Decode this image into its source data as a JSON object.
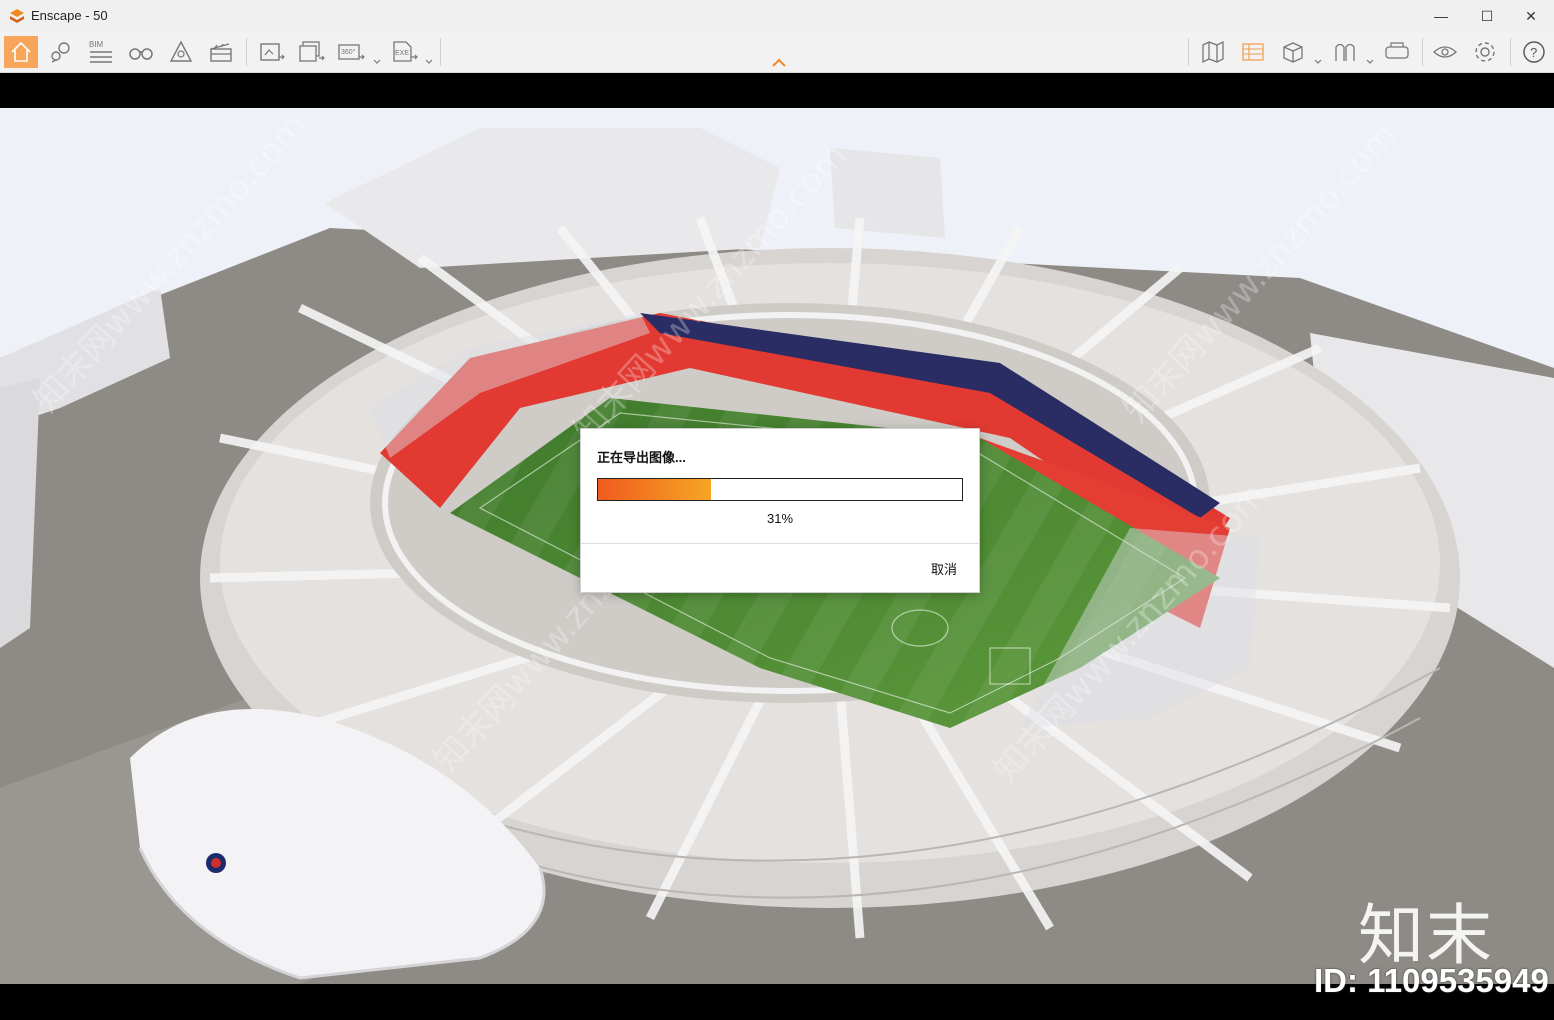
{
  "window": {
    "title": "Enscape - 50",
    "minimize": "—",
    "maximize": "☐",
    "close": "✕"
  },
  "toolbar": {
    "left_icons": [
      "home-icon",
      "views-pin-icon",
      "bim-icon",
      "binoculars-icon",
      "asset-library-icon",
      "video-editor-icon",
      "screenshot-icon",
      "batch-render-icon",
      "panorama-360-icon",
      "export-exe-icon"
    ],
    "right_icons": [
      "map-icon",
      "settings-panel-icon",
      "view-mode-icon",
      "ribbon-icon",
      "vr-headset-icon",
      "visibility-icon",
      "gear-icon",
      "help-icon"
    ],
    "bim_label": "BIM",
    "pano_label": "360°",
    "exe_label": "EXE",
    "collapse_icon": "chevron-up-icon",
    "help_label": "?"
  },
  "colors": {
    "accent": "#f6a55a",
    "progress_start": "#ef5b1f",
    "progress_end": "#f6a623"
  },
  "dialog": {
    "title": "正在导出图像...",
    "progress": 0.31,
    "progress_text": "31%",
    "cancel": "取消"
  },
  "watermark": {
    "brand": "知末",
    "id": "ID: 1109535949",
    "diagonal": "知末网www.znzmo.com"
  }
}
